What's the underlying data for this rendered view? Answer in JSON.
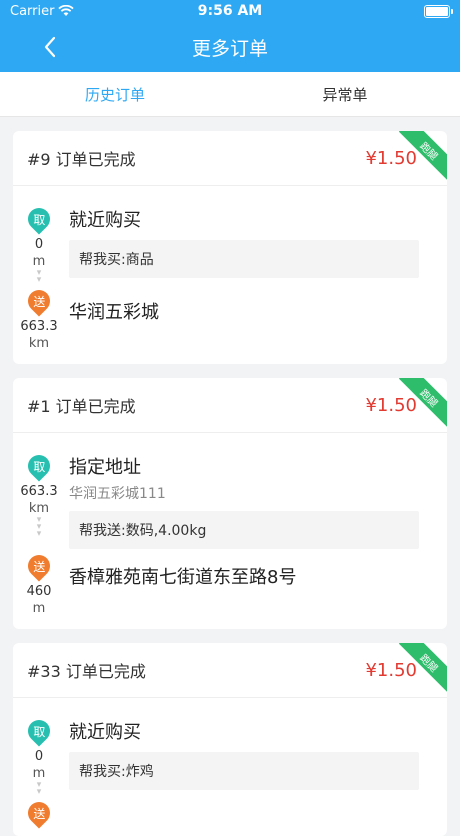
{
  "status": {
    "carrier": "Carrier",
    "time": "9:56 AM"
  },
  "nav": {
    "title": "更多订单"
  },
  "tabs": [
    {
      "label": "历史订单"
    },
    {
      "label": "异常单"
    }
  ],
  "orders": [
    {
      "title": "#9 订单已完成",
      "price": "¥1.50",
      "ribbon": "跑腿",
      "pickup": {
        "badge": "取",
        "dist": "0",
        "unit": "m",
        "addr": "就近购买",
        "sub": "",
        "note": "帮我买:商品"
      },
      "dropoff": {
        "badge": "送",
        "dist": "663.3",
        "unit": "km",
        "addr": "华润五彩城"
      }
    },
    {
      "title": "#1 订单已完成",
      "price": "¥1.50",
      "ribbon": "跑腿",
      "pickup": {
        "badge": "取",
        "dist": "663.3",
        "unit": "km",
        "addr": "指定地址",
        "sub": "华润五彩城111",
        "note": "帮我送:数码,4.00kg"
      },
      "dropoff": {
        "badge": "送",
        "dist": "460",
        "unit": "m",
        "addr": "香樟雅苑南七街道东至路8号"
      }
    },
    {
      "title": "#33 订单已完成",
      "price": "¥1.50",
      "ribbon": "跑腿",
      "pickup": {
        "badge": "取",
        "dist": "0",
        "unit": "m",
        "addr": "就近购买",
        "sub": "",
        "note": "帮我买:炸鸡"
      },
      "dropoff": {
        "badge": "送",
        "dist": "",
        "unit": "",
        "addr": ""
      }
    }
  ]
}
